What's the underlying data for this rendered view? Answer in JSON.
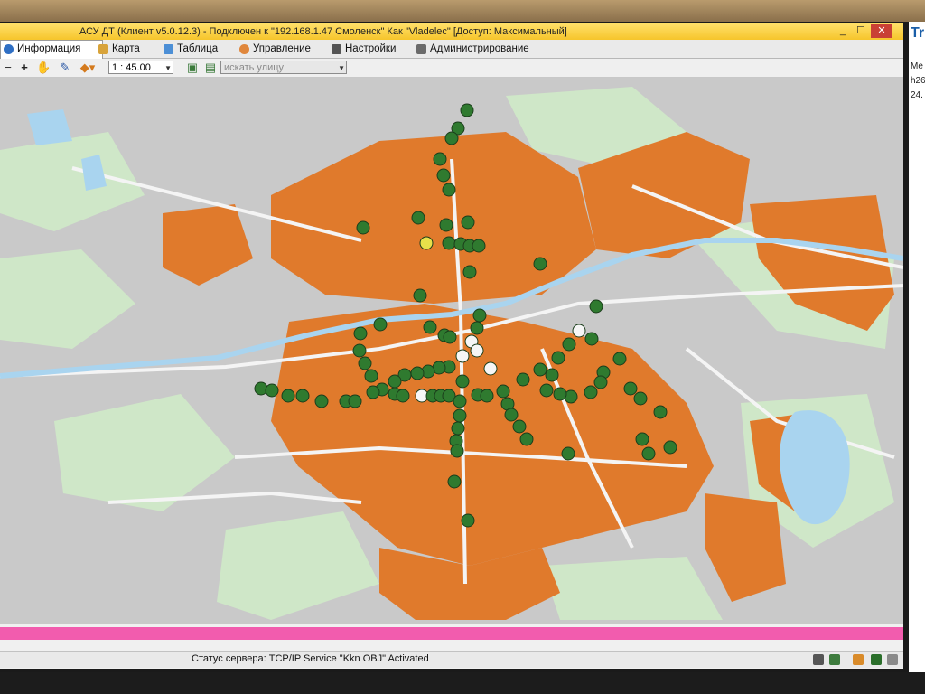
{
  "window": {
    "title": "АСУ ДТ (Клиент v5.0.12.3) - Подключен к \"192.168.1.47 Смоленск\" Как \"Vladelec\" [Доступ: Максимальный]",
    "controls": {
      "minimize": "_",
      "maximize": "☐",
      "close": "✕"
    }
  },
  "tabs": [
    {
      "label": "Информация",
      "icon": "info-icon",
      "active": true
    },
    {
      "label": "Карта",
      "icon": "map-icon",
      "active": false
    },
    {
      "label": "Таблица",
      "icon": "table-icon",
      "active": false
    },
    {
      "label": "Управление",
      "icon": "control-icon",
      "active": false
    },
    {
      "label": "Настройки",
      "icon": "settings-icon",
      "active": false
    },
    {
      "label": "Администрирование",
      "icon": "admin-icon",
      "active": false
    }
  ],
  "toolbar": {
    "zoom_out": "−",
    "zoom_in": "+",
    "scale": "1 : 45.00",
    "street_search_placeholder": "искать улицу"
  },
  "map": {
    "colors": {
      "background": "#c9c9c9",
      "buildings": "#e07a2c",
      "parks": "#cfe7c8",
      "water": "#a9d4ef",
      "roads": "#f4f4f4",
      "marker_normal": "#2f7a2f",
      "marker_offline": "#f6f6f6",
      "marker_warning": "#e8e04a"
    },
    "legend_states": [
      "normal",
      "offline",
      "warning"
    ]
  },
  "status": {
    "text": "Статус сервера: TCP/IP Service \"Kkn OBJ\" Activated"
  },
  "side_panel": {
    "brand": "Tr",
    "lines": [
      "Me",
      "h26",
      "24."
    ]
  }
}
